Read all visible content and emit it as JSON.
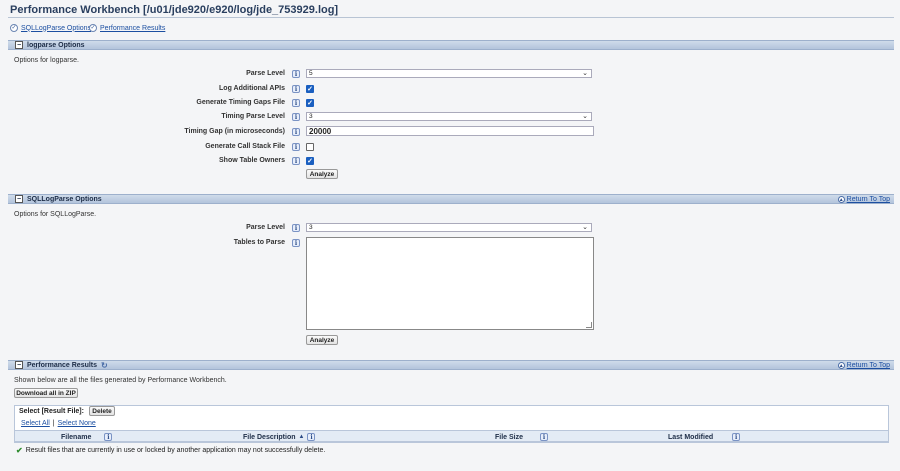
{
  "page": {
    "title": "Performance Workbench [/u01/jde920/e920/log/jde_753929.log]"
  },
  "nav": {
    "sqllogparse_options": "SQLLogParse Options",
    "performance_results": "Performance Results"
  },
  "logparse": {
    "section_title": "logparse Options",
    "description": "Options for logparse.",
    "fields": {
      "parse_level": {
        "label": "Parse Level",
        "value": "5"
      },
      "log_additional_apis": {
        "label": "Log Additional APIs",
        "checked": true
      },
      "generate_timing_gaps_file": {
        "label": "Generate Timing Gaps File",
        "checked": true
      },
      "timing_parse_level": {
        "label": "Timing Parse Level",
        "value": "3"
      },
      "timing_gap": {
        "label": "Timing Gap (in microseconds)",
        "value": "20000"
      },
      "generate_call_stack_file": {
        "label": "Generate Call Stack File",
        "checked": false
      },
      "show_table_owners": {
        "label": "Show Table Owners",
        "checked": true
      }
    },
    "analyze_label": "Analyze"
  },
  "sqllogparse": {
    "section_title": "SQLLogParse Options",
    "return_to_top": "Return To Top",
    "description": "Options for SQLLogParse.",
    "parse_level": {
      "label": "Parse Level",
      "value": "3"
    },
    "tables_to_parse": {
      "label": "Tables to Parse",
      "value": ""
    },
    "analyze_label": "Analyze"
  },
  "results": {
    "section_title": "Performance Results",
    "return_to_top": "Return To Top",
    "description": "Shown below are all the files generated by Performance Workbench.",
    "download_all_label": "Download all in ZIP",
    "select_result_file_label": "Select [Result File]:",
    "delete_label": "Delete",
    "select_all": "Select All",
    "select_none": "Select None",
    "separator": "|",
    "columns": [
      "Filename",
      "File Description",
      "File Size",
      "Last Modified"
    ],
    "rows": [],
    "warning": "Result files that are currently in use or locked by another application may not successfully delete."
  },
  "icons": {
    "info": "info-icon",
    "collapse": "collapse-icon",
    "return_top": "up-arrow-icon",
    "refresh": "refresh-icon",
    "nav": "circle-chevron-icon"
  },
  "colors": {
    "section_bar": "#b3c4dc",
    "link": "#1c4fa1",
    "checkbox": "#1a5fc0",
    "title": "#2a3f5f"
  }
}
